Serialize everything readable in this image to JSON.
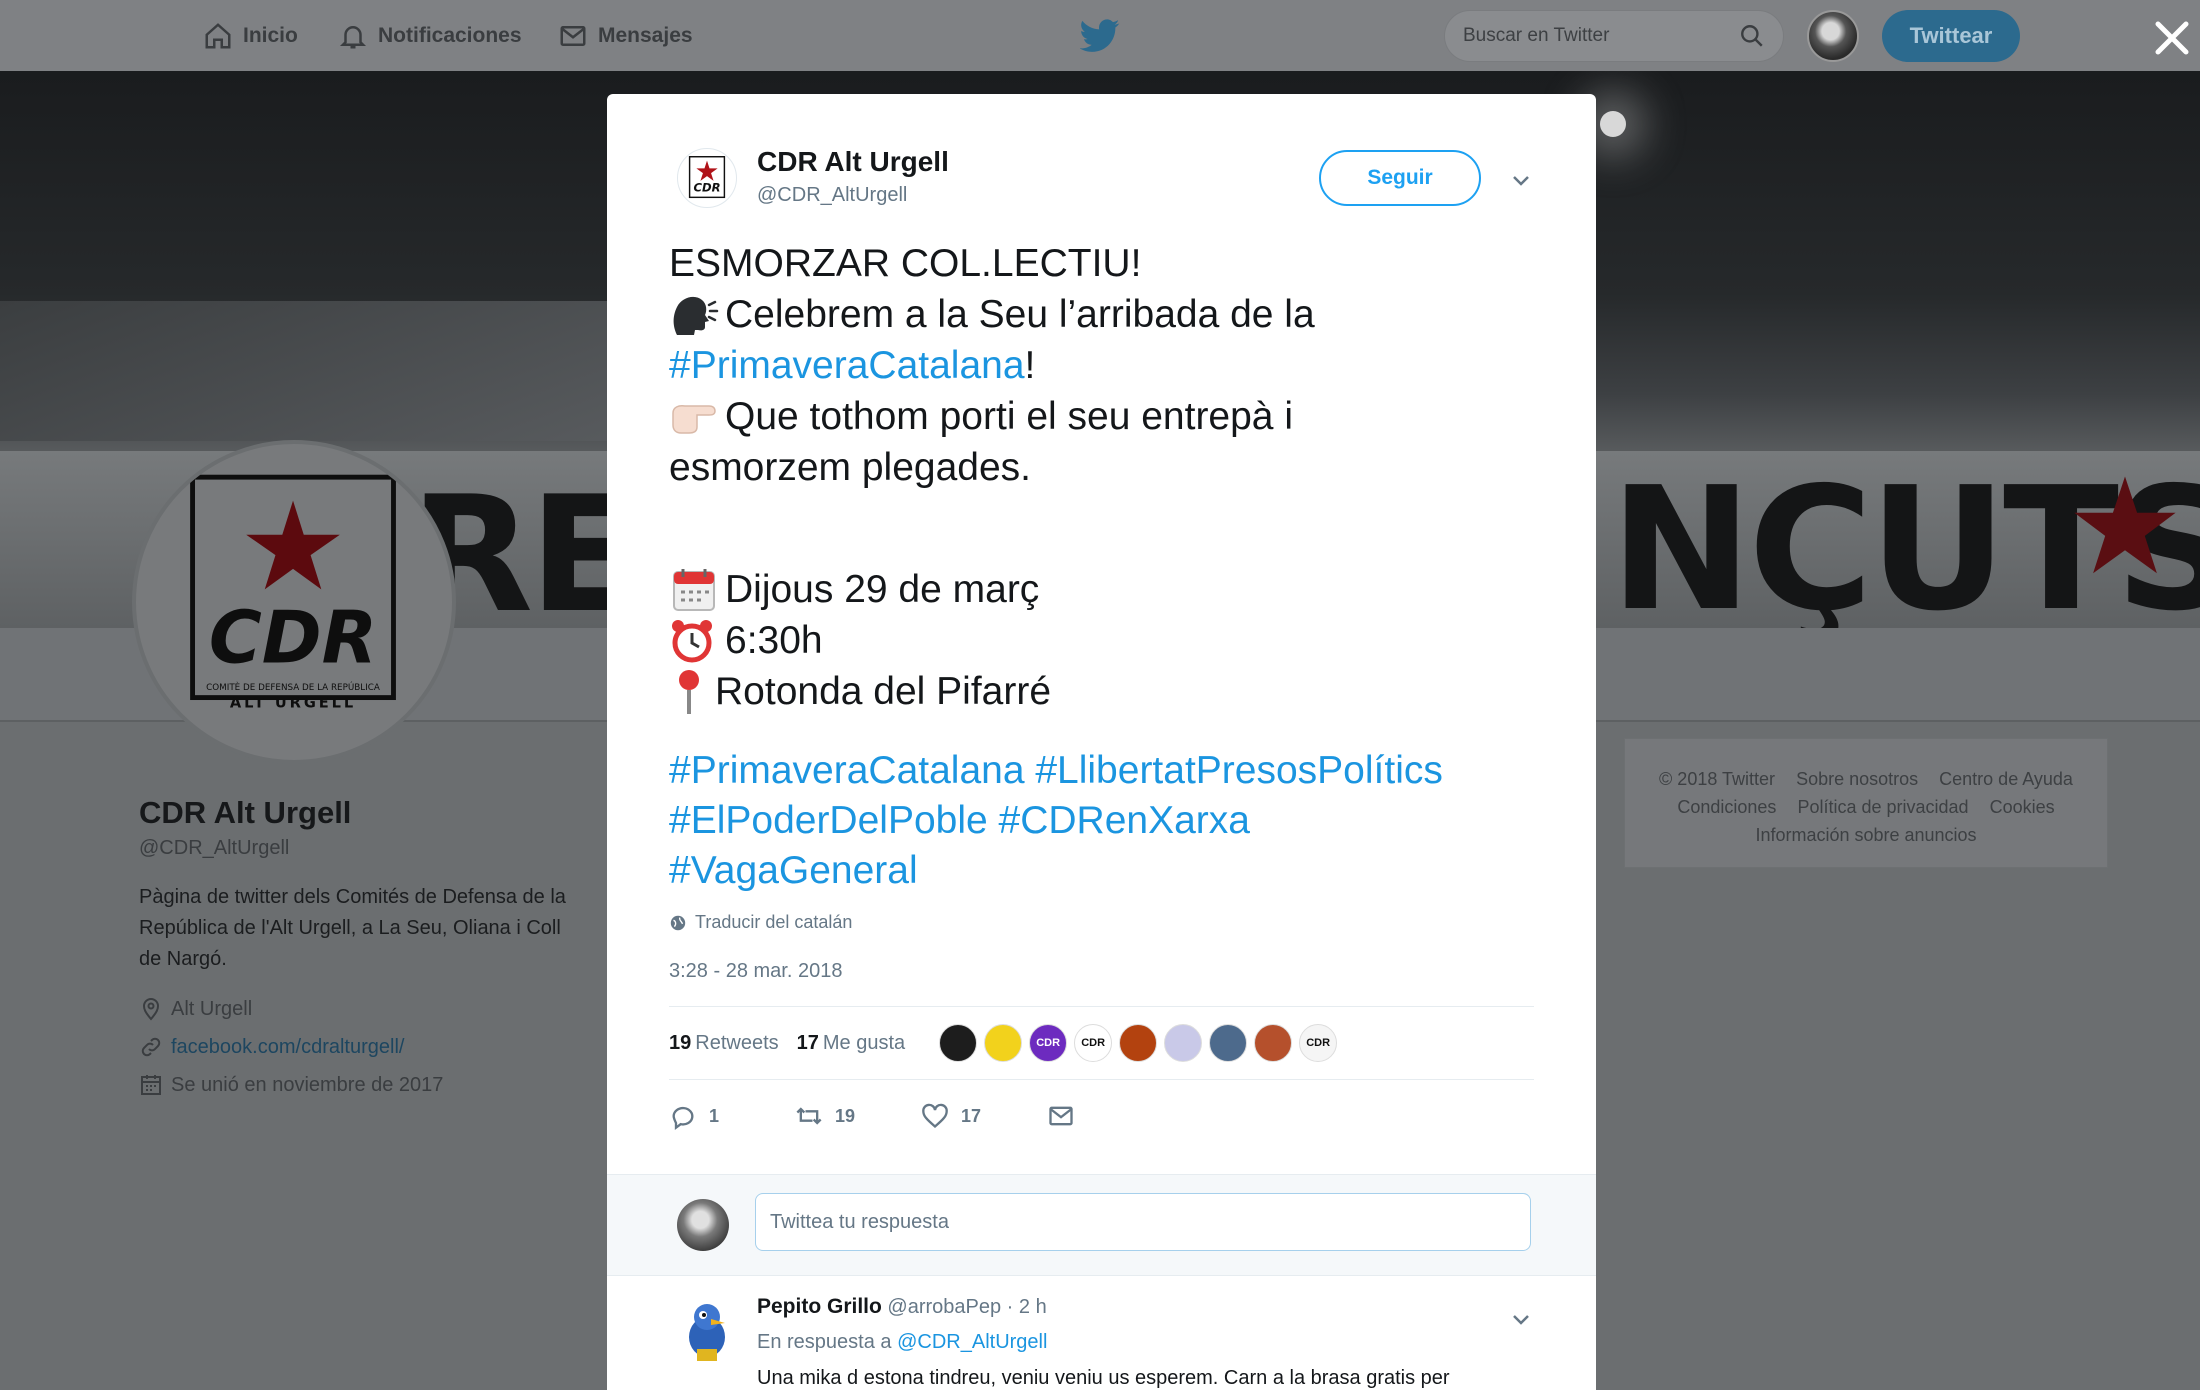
{
  "nav": {
    "home_label": "Inicio",
    "notifications_label": "Notificaciones",
    "messages_label": "Mensajes",
    "search_placeholder": "Buscar en Twitter",
    "tweet_button": "Twittear"
  },
  "cover": {
    "banner_left": "RES",
    "banner_right": "NÇUTS"
  },
  "profile": {
    "name": "CDR Alt Urgell",
    "handle": "@CDR_AltUrgell",
    "bio": "Pàgina de twitter dels Comités de Defensa de la República de l'Alt Urgell, a La Seu, Oliana i Coll de Nargó.",
    "location": "Alt Urgell",
    "link": "facebook.com/cdralturgell/",
    "joined": "Se unió en noviembre de 2017",
    "logo_text": "CDR",
    "logo_sub1": "COMITÈ DE DEFENSA DE LA REPÚBLICA",
    "logo_sub2": "ALT URGELL"
  },
  "footer": {
    "links_row1": [
      "© 2018 Twitter",
      "Sobre nosotros",
      "Centro de Ayuda"
    ],
    "links_row2": [
      "Condiciones",
      "Política de privacidad",
      "Cookies"
    ],
    "links_row3": [
      "Información sobre anuncios"
    ]
  },
  "tweet": {
    "author_name": "CDR Alt Urgell",
    "author_handle": "@CDR_AltUrgell",
    "follow_label": "Seguir",
    "line1": "ESMORZAR COL.LECTIU!",
    "line2": " Celebrem a la Seu l’arribada de la",
    "line3_tag": "#PrimaveraCatalana",
    "line3_rest": "!",
    "line4": "Que tothom porti el seu entrepà i",
    "line5": "esmorzem plegades.",
    "date_line": " Dijous 29 de març",
    "time_line": " 6:30h",
    "place_line": "Rotonda del Pifarré",
    "hashtags_line1": "#PrimaveraCatalana #LlibertatPresosPolítics",
    "hashtags_line2": "#ElPoderDelPoble #CDRenXarxa",
    "hashtags_line3": "#VagaGeneral",
    "translate_label": "Traducir del catalán",
    "timestamp": "3:28 - 28 mar. 2018",
    "retweets_count": "19",
    "retweets_label": "Retweets",
    "likes_count": "17",
    "likes_label": "Me gusta",
    "reply_count": "1",
    "retweet_action_count": "19",
    "like_action_count": "17",
    "liker_avatars": [
      "dark-avatar",
      "yellow-avatar",
      "purple-cdr-avatar",
      "cdr-bw-avatar",
      "orange-avatar",
      "flag-avatar",
      "building-avatar",
      "monkey-avatar",
      "cdr-logo-avatar"
    ],
    "liker_labels": [
      "",
      "",
      "CDR",
      "CDR",
      "",
      "",
      "",
      "",
      "CDR"
    ]
  },
  "reply_box": {
    "placeholder": "Twittea tu respuesta"
  },
  "reply": {
    "author_name": "Pepito Grillo",
    "author_handle": "@arrobaPep",
    "age": "· 2 h",
    "in_reply_prefix": "En respuesta a",
    "in_reply_handle": "@CDR_AltUrgell",
    "text": "Una mika d estona tindreu, veniu veniu us esperem. Carn a la brasa gratis per"
  },
  "colors": {
    "accent": "#1da1f2",
    "hashtag": "#1b95e0",
    "overlay": "#6b6e70",
    "cdr_red": "#8b0d12"
  }
}
